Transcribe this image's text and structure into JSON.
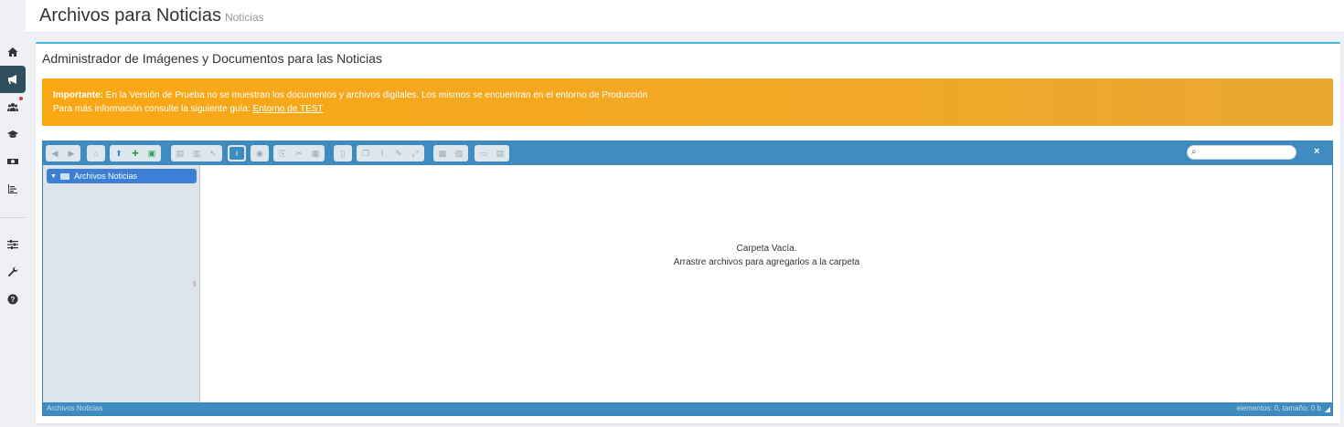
{
  "header": {
    "title": "Archivos para Noticias",
    "subtitle": "Noticias"
  },
  "sidebar": {
    "items": [
      {
        "icon": "home-icon"
      },
      {
        "icon": "megaphone-icon",
        "active": true
      },
      {
        "icon": "users-icon",
        "badge": true
      },
      {
        "icon": "graduation-cap-icon"
      },
      {
        "icon": "money-icon"
      },
      {
        "icon": "chart-icon"
      },
      {
        "icon": "sliders-icon"
      },
      {
        "icon": "wrench-icon"
      },
      {
        "icon": "help-icon"
      }
    ]
  },
  "card": {
    "title": "Administrador de Imágenes y Documentos para las Noticias"
  },
  "alert": {
    "strong": "Importante:",
    "line1": " En la Versión de Prueba no se muestran los documentos y archivos digitales. Los mismos se encuentran en el entorno de Producción",
    "line2": "Para más información consulte la siguiente guía: ",
    "link": "Entorno de TEST",
    "color": "#f9a814"
  },
  "file_manager": {
    "tree_root": "Archivos Noticias",
    "empty_line1": "Carpeta Vacía.",
    "empty_line2": "Arrastre archivos para agregarlos a la carpeta",
    "status_left": "Archivos Noticias",
    "status_right": "elementos: 0, tamaño: 0 b",
    "close_label": "×",
    "toolbar_color": "#3e8bbf"
  }
}
